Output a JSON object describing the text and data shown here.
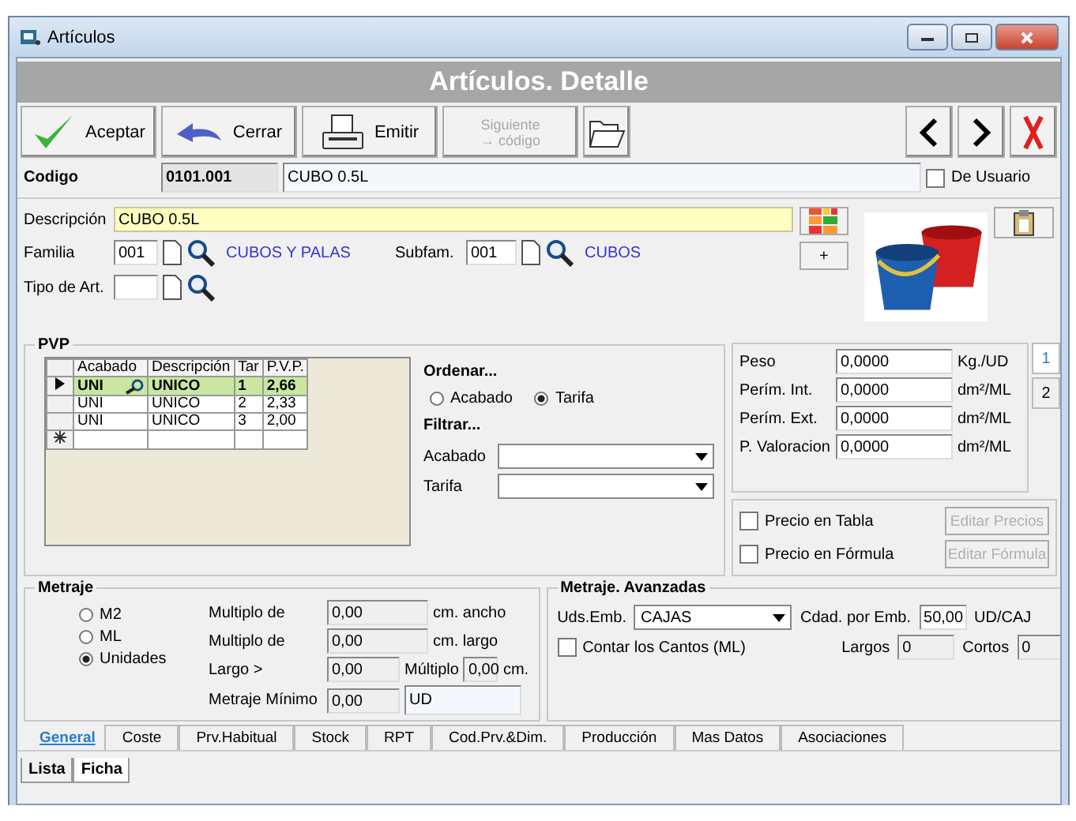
{
  "window": {
    "title": "Artículos"
  },
  "header": {
    "title": "Artículos. Detalle"
  },
  "toolbar": {
    "buttons": [
      {
        "label": "Aceptar",
        "kind": "accept",
        "disabled": false
      },
      {
        "label": "Cerrar",
        "kind": "close",
        "disabled": false
      },
      {
        "label": "Emitir",
        "kind": "print",
        "disabled": false
      },
      {
        "label": "Siguiente\n→ código",
        "kind": "next",
        "disabled": true
      },
      {
        "kind": "open",
        "disabled": false
      }
    ]
  },
  "codigo": {
    "label": "Codigo",
    "code": "0101.001",
    "name": "CUBO 0.5L",
    "de_usuario": {
      "label": "De Usuario",
      "checked": false
    }
  },
  "descripcion": {
    "label": "Descripción",
    "value": "CUBO 0.5L"
  },
  "familia": {
    "label": "Familia",
    "code": "001",
    "name": "CUBOS Y PALAS"
  },
  "subfamilia": {
    "label": "Subfam.",
    "code": "001",
    "name": "CUBOS"
  },
  "tipo_art": {
    "label": "Tipo de Art."
  },
  "plus_button": "+",
  "pvp": {
    "title": "PVP",
    "columns": [
      "Acabado",
      "Descripción",
      "Tar",
      "P.V.P."
    ],
    "rows": [
      {
        "acabado": "UNI",
        "descripcion": "UNICO",
        "tar": "1",
        "pvp": "2,66",
        "selected": true
      },
      {
        "acabado": "UNI",
        "descripcion": "UNICO",
        "tar": "2",
        "pvp": "2,33",
        "selected": false
      },
      {
        "acabado": "UNI",
        "descripcion": "UNICO",
        "tar": "3",
        "pvp": "2,00",
        "selected": false
      }
    ],
    "ordenar": "Ordenar...",
    "sort_options": [
      {
        "label": "Acabado",
        "selected": false
      },
      {
        "label": "Tarifa",
        "selected": true
      }
    ],
    "filtrar": "Filtrar...",
    "filters": [
      {
        "label": "Acabado"
      },
      {
        "label": "Tarifa"
      }
    ]
  },
  "medidas": {
    "rows": [
      {
        "label": "Peso",
        "value": "0,0000",
        "unit": "Kg./UD"
      },
      {
        "label": "Perím. Int.",
        "value": "0,0000",
        "unit": "dm²/ML"
      },
      {
        "label": "Perím. Ext.",
        "value": "0,0000",
        "unit": "dm²/ML"
      },
      {
        "label": "P. Valoracion",
        "value": "0,0000",
        "unit": "dm²/ML"
      }
    ],
    "pages": [
      {
        "label": "1",
        "selected": true
      },
      {
        "label": "2",
        "selected": false
      }
    ]
  },
  "precio_options": [
    {
      "label": "Precio en Tabla",
      "checked": false,
      "button": "Editar Precios",
      "disabled": true
    },
    {
      "label": "Precio en Fórmula",
      "checked": false,
      "button": "Editar Fórmula",
      "disabled": true
    }
  ],
  "metraje": {
    "title": "Metraje",
    "modes": [
      {
        "label": "M2",
        "selected": false
      },
      {
        "label": "ML",
        "selected": false
      },
      {
        "label": "Unidades",
        "selected": true
      }
    ],
    "fields": [
      {
        "label": "Multiplo de",
        "value": "0,00",
        "unit": "cm. ancho"
      },
      {
        "label": "Multiplo de",
        "value": "0,00",
        "unit": "cm. largo"
      },
      {
        "label": "Largo >",
        "value": "0,00",
        "extra_label": "Múltiplo",
        "extra_value": "0,00",
        "unit": "cm."
      },
      {
        "label": "Metraje Mínimo",
        "value": "0,00",
        "extra_value": "UD"
      }
    ]
  },
  "avanzadas": {
    "title": "Metraje. Avanzadas",
    "uds_label": "Uds.Emb.",
    "uds_value": "CAJAS",
    "cdad_label": "Cdad. por Emb.",
    "cdad_value": "50,00",
    "cdad_unit": "UD/CAJ",
    "contar": {
      "label": "Contar los Cantos (ML)",
      "checked": false
    },
    "largos_label": "Largos",
    "largos_value": "0",
    "cortos_label": "Cortos",
    "cortos_value": "0"
  },
  "tabs": [
    {
      "label": "General",
      "selected": true
    },
    {
      "label": "Coste",
      "selected": false
    },
    {
      "label": "Prv.Habitual",
      "selected": false
    },
    {
      "label": "Stock",
      "selected": false
    },
    {
      "label": "RPT",
      "selected": false
    },
    {
      "label": "Cod.Prv.&Dim.",
      "selected": false
    },
    {
      "label": "Producción",
      "selected": false
    },
    {
      "label": "Mas Datos",
      "selected": false
    },
    {
      "label": "Asociaciones",
      "selected": false
    }
  ],
  "view_tabs": [
    {
      "label": "Lista",
      "selected": false
    },
    {
      "label": "Ficha",
      "selected": true
    }
  ]
}
